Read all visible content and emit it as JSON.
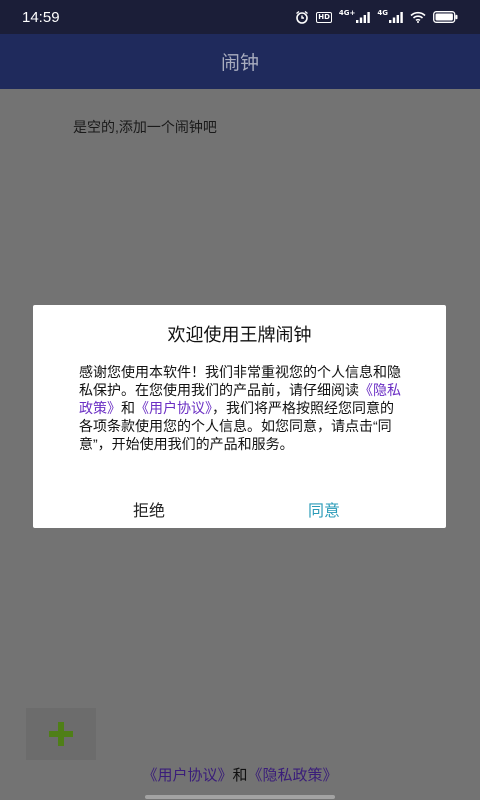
{
  "status_bar": {
    "time": "14:59",
    "hd_label": "HD",
    "network_1": "4G+",
    "network_2": "4G",
    "battery_color": "#ffffff"
  },
  "app_bar": {
    "title": "闹钟"
  },
  "main": {
    "empty_message": "是空的,添加一个闹钟吧"
  },
  "fab": {
    "icon": "plus-icon",
    "color": "#4f7f17"
  },
  "footer": {
    "user_agreement": "《用户协议》",
    "conjunction": "和",
    "privacy_policy": "《隐私政策》"
  },
  "dialog": {
    "title": "欢迎使用王牌闹钟",
    "body_1": "感谢您使用本软件！我们非常重视您的个人信息和隐私保护。在您使用我们的产品前，请仔细阅读",
    "privacy_link": "《隐私政策》",
    "body_2": "和",
    "agreement_link": "《用户协议》",
    "body_3": "，我们将严格按照经您同意的各项条款使用您的个人信息。如您同意，请点击“同意”，开始使用我们的产品和服务。",
    "reject_label": "拒绝",
    "agree_label": "同意",
    "agree_color": "#2a9bb8",
    "link_color": "#6b2fc4"
  }
}
